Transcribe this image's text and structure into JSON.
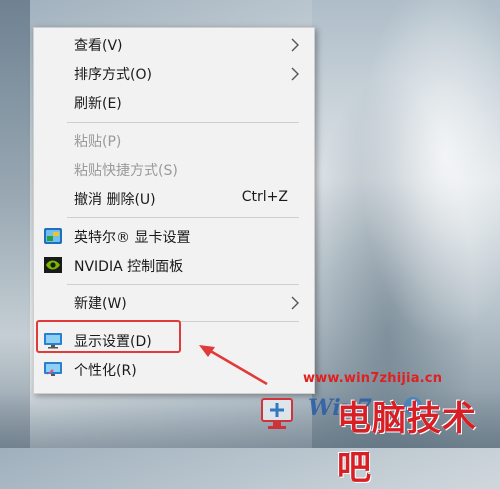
{
  "menu": {
    "items": [
      {
        "label": "查看(V)",
        "has_submenu": true
      },
      {
        "label": "排序方式(O)",
        "has_submenu": true
      },
      {
        "label": "刷新(E)"
      },
      {
        "label": "粘贴(P)",
        "disabled": true
      },
      {
        "label": "粘贴快捷方式(S)",
        "disabled": true
      },
      {
        "label": "撤消 删除(U)",
        "shortcut": "Ctrl+Z"
      },
      {
        "label": "英特尔® 显卡设置",
        "icon": "intel-graphics-icon"
      },
      {
        "label": "NVIDIA 控制面板",
        "icon": "nvidia-icon"
      },
      {
        "label": "新建(W)",
        "has_submenu": true
      },
      {
        "label": "显示设置(D)",
        "icon": "display-settings-icon"
      },
      {
        "label": "个性化(R)",
        "icon": "personalize-icon"
      }
    ]
  },
  "annotation": {
    "highlight_color": "#e03a3a"
  },
  "watermark": {
    "url": "www.win7zhijia.cn",
    "brand": "电脑技术吧"
  }
}
